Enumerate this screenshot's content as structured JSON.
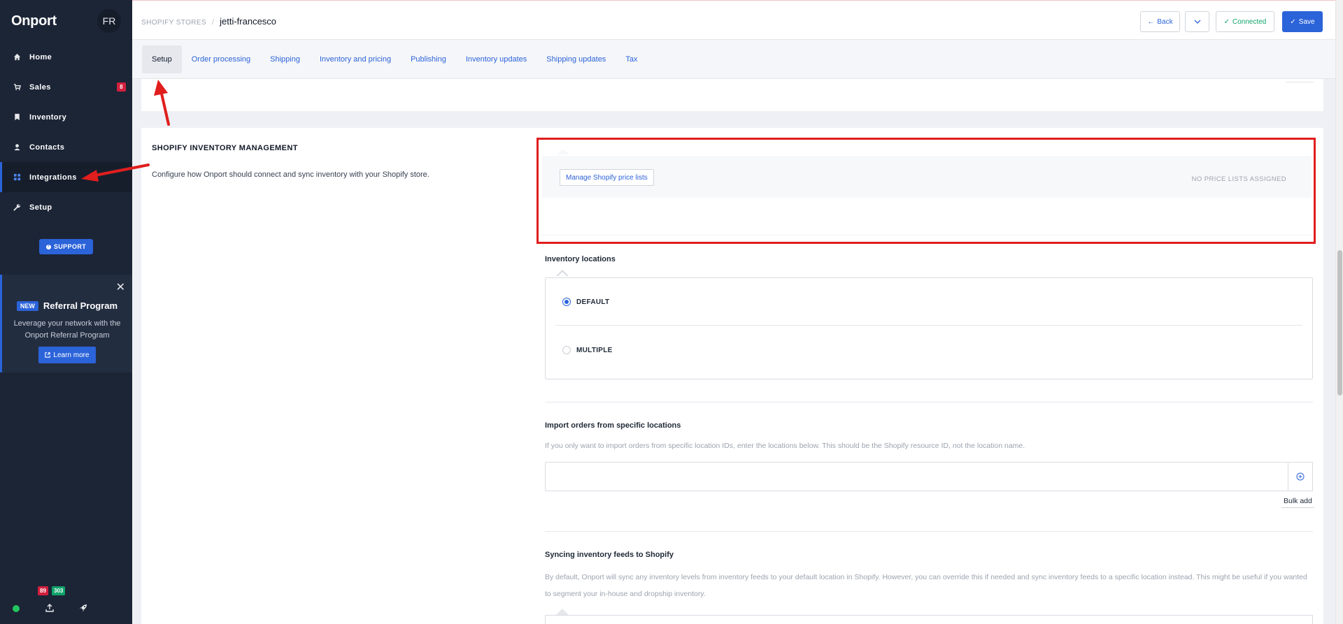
{
  "sidebar": {
    "logo": "Onport",
    "avatar": "FR",
    "items": [
      {
        "label": "Home",
        "icon": "home-icon"
      },
      {
        "label": "Sales",
        "icon": "cart-icon",
        "badge": "8"
      },
      {
        "label": "Inventory",
        "icon": "bookmark-icon"
      },
      {
        "label": "Contacts",
        "icon": "user-icon"
      },
      {
        "label": "Integrations",
        "icon": "grid-icon"
      },
      {
        "label": "Setup",
        "icon": "wrench-icon"
      }
    ],
    "support_label": "SUPPORT",
    "referral": {
      "badge": "NEW",
      "title": "Referral Program",
      "text": "Leverage your network with the Onport Referral Program",
      "button": "Learn more"
    },
    "bottom": {
      "badge_red": "89",
      "badge_green": "303"
    }
  },
  "header": {
    "breadcrumb_parent": "SHOPIFY STORES",
    "breadcrumb_sep": "/",
    "breadcrumb_current": "jetti-francesco",
    "back_label": "Back",
    "connected_label": "Connected",
    "save_label": "Save"
  },
  "tabs": [
    {
      "label": "Setup",
      "active": true
    },
    {
      "label": "Order processing"
    },
    {
      "label": "Shipping"
    },
    {
      "label": "Inventory and pricing"
    },
    {
      "label": "Publishing"
    },
    {
      "label": "Inventory updates"
    },
    {
      "label": "Shipping updates"
    },
    {
      "label": "Tax"
    }
  ],
  "section": {
    "title": "SHOPIFY INVENTORY MANAGEMENT",
    "description": "Configure how Onport should connect and sync inventory with your Shopify store.",
    "manage_button": "Manage Shopify price lists",
    "no_price_lists": "NO PRICE LISTS ASSIGNED",
    "inventory_locations_label": "Inventory locations",
    "option_default": "DEFAULT",
    "option_multiple": "MULTIPLE",
    "selected_option": "DEFAULT",
    "import_title": "Import orders from specific locations",
    "import_desc": "If you only want to import orders from specific location IDs, enter the locations below. This should be the Shopify resource ID, not the location name.",
    "bulk_add": "Bulk add",
    "sync_title": "Syncing inventory feeds to Shopify",
    "sync_desc": "By default, Onport will sync any inventory levels from inventory feeds to your default location in Shopify. However, you can override this if needed and sync inventory feeds to a specific location instead. This might be useful if you wanted to segment your in-house and dropship inventory."
  },
  "colors": {
    "accent": "#2b63d9",
    "sidebar_bg": "#1c2536",
    "annotation_red": "#e01e1e",
    "success": "#10a36b",
    "danger": "#d21f3c"
  }
}
